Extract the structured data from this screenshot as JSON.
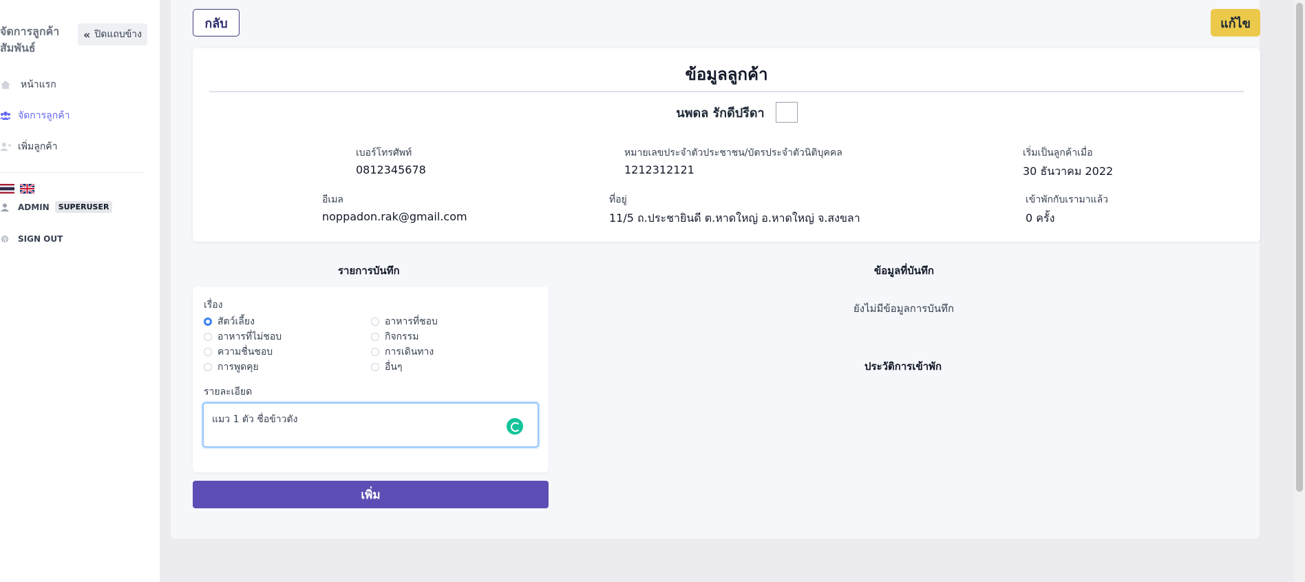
{
  "sidebar": {
    "brand": "จัดการลูกค้าสัมพันธ์",
    "collapse_label": "ปิดแถบข้าง",
    "items": [
      {
        "label": "หน้าแรก",
        "icon": "home-icon"
      },
      {
        "label": "จัดการลูกค้า",
        "icon": "users-icon",
        "active": true
      },
      {
        "label": "เพิ่มลูกค้า",
        "icon": "user-plus-icon"
      }
    ],
    "user": {
      "name": "ADMIN",
      "role": "SUPERUSER"
    },
    "signout_label": "SIGN OUT"
  },
  "header": {
    "back_label": "กลับ",
    "edit_label": "แก้ไข"
  },
  "customer": {
    "title": "ข้อมูลลูกค้า",
    "name": "นพดล รักดีปรีดา",
    "phone_label": "เบอร์โทรศัพท์",
    "phone": "0812345678",
    "id_label": "หมายเลขประจำตัวประชาชน/บัตรประจำตัวนิติบุคคล",
    "id": "1212312121",
    "since_label": "เริ่มเป็นลูกค้าเมื่อ",
    "since": "30 ธันวาคม 2022",
    "email_label": "อีเมล",
    "email": "noppadon.rak@gmail.com",
    "address_label": "ที่อยู่",
    "address": "11/5 ถ.ประชายินดี ต.หาดใหญ่ อ.หาดใหญ่ จ.สงขลา",
    "stays_label": "เข้าพักกับเรามาแล้ว",
    "stays": "0 ครั้ง"
  },
  "notes": {
    "section_title": "รายการบันทึก",
    "subject_label": "เรื่อง",
    "options": [
      {
        "label": "สัตว์เลี้ยง",
        "selected": true
      },
      {
        "label": "อาหารที่ชอบ",
        "selected": false
      },
      {
        "label": "อาหารที่ไม่ชอบ",
        "selected": false
      },
      {
        "label": "กิจกรรม",
        "selected": false
      },
      {
        "label": "ความชื่นชอบ",
        "selected": false
      },
      {
        "label": "การเดินทาง",
        "selected": false
      },
      {
        "label": "การพูดคุย",
        "selected": false
      },
      {
        "label": "อื่นๆ",
        "selected": false
      }
    ],
    "detail_label": "รายละเอียด",
    "detail_value": "แมว 1 ตัว ชื่อข้าวตัง",
    "add_label": "เพิ่ม"
  },
  "saved": {
    "section_title": "ข้อมูลที่บันทึก",
    "empty_message": "ยังไม่มีข้อมูลการบันทึก",
    "history_title": "ประวัติการเข้าพัก"
  },
  "colors": {
    "accent": "#5b4eb4",
    "edit": "#ecc94b",
    "active_nav": "#6366f1"
  }
}
